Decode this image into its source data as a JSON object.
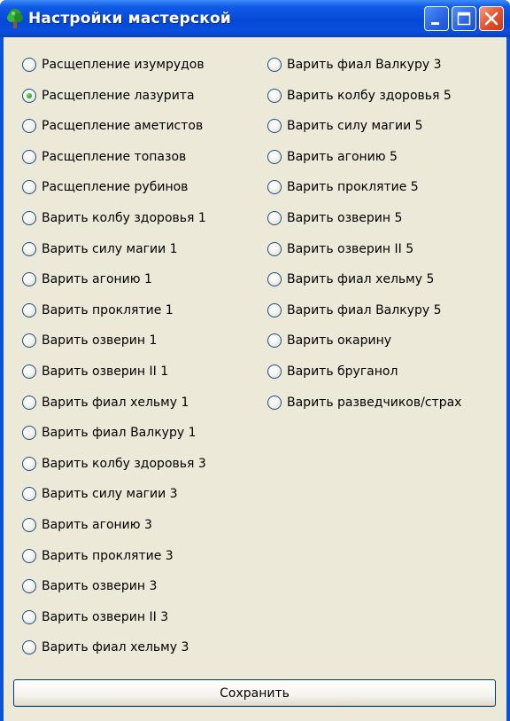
{
  "window": {
    "title": "Настройки мастерской",
    "app_icon": "tree-icon",
    "controls": {
      "minimize": "minimize-icon",
      "maximize": "maximize-icon",
      "close": "close-icon"
    }
  },
  "options": {
    "left": [
      {
        "label": "Расщепление изумрудов",
        "checked": false
      },
      {
        "label": "Расщепление лазурита",
        "checked": true
      },
      {
        "label": "Расщепление аметистов",
        "checked": false
      },
      {
        "label": "Расщепление топазов",
        "checked": false
      },
      {
        "label": "Расщепление рубинов",
        "checked": false
      },
      {
        "label": "Варить колбу здоровья 1",
        "checked": false
      },
      {
        "label": "Варить силу магии 1",
        "checked": false
      },
      {
        "label": "Варить агонию 1",
        "checked": false
      },
      {
        "label": "Варить проклятие 1",
        "checked": false
      },
      {
        "label": "Варить озверин 1",
        "checked": false
      },
      {
        "label": "Варить озверин II 1",
        "checked": false
      },
      {
        "label": "Варить фиал хельму 1",
        "checked": false
      },
      {
        "label": "Варить фиал Валкуру 1",
        "checked": false
      },
      {
        "label": "Варить колбу здоровья 3",
        "checked": false
      },
      {
        "label": "Варить силу магии 3",
        "checked": false
      },
      {
        "label": "Варить агонию 3",
        "checked": false
      },
      {
        "label": "Варить проклятие 3",
        "checked": false
      },
      {
        "label": "Варить озверин 3",
        "checked": false
      },
      {
        "label": "Варить озверин II 3",
        "checked": false
      },
      {
        "label": "Варить фиал хельму 3",
        "checked": false
      }
    ],
    "right": [
      {
        "label": "Варить фиал Валкуру 3",
        "checked": false
      },
      {
        "label": "Варить колбу здоровья 5",
        "checked": false
      },
      {
        "label": "Варить силу магии 5",
        "checked": false
      },
      {
        "label": "Варить агонию 5",
        "checked": false
      },
      {
        "label": "Варить проклятие 5",
        "checked": false
      },
      {
        "label": "Варить озверин 5",
        "checked": false
      },
      {
        "label": "Варить озверин II 5",
        "checked": false
      },
      {
        "label": "Варить фиал хельму 5",
        "checked": false
      },
      {
        "label": "Варить фиал Валкуру 5",
        "checked": false
      },
      {
        "label": "Варить окарину",
        "checked": false
      },
      {
        "label": "Варить бруганол",
        "checked": false
      },
      {
        "label": "Варить разведчиков/страх",
        "checked": false
      }
    ]
  },
  "footer": {
    "save_label": "Сохранить"
  },
  "colors": {
    "titlebar": "#0648d6",
    "client_bg": "#ece9d8",
    "radio_checked": "#21a121",
    "close_button": "#e0512c"
  }
}
